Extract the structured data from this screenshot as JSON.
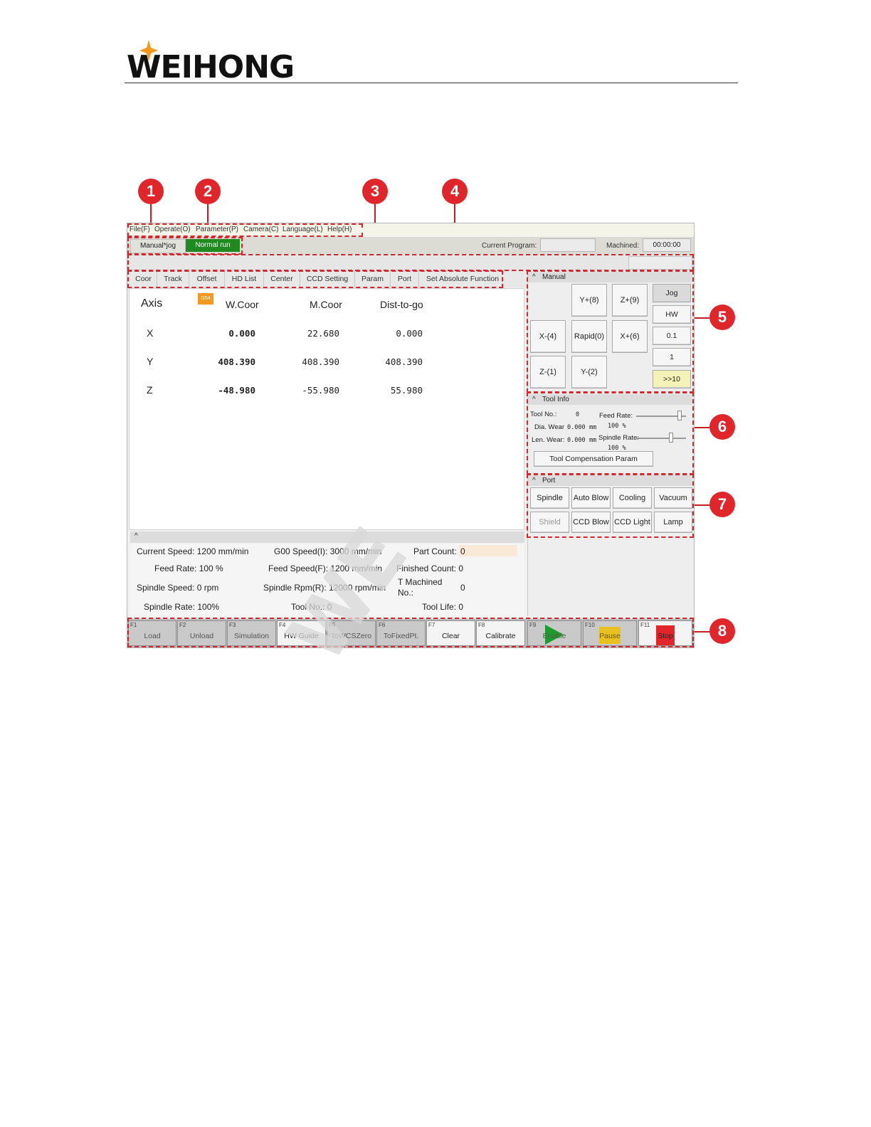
{
  "brand": {
    "name": "WEIHONG",
    "star_color": "#f39a1e"
  },
  "callouts": [
    "1",
    "2",
    "3",
    "4",
    "5",
    "6",
    "7",
    "8"
  ],
  "menu": [
    "File(F)",
    "Operate(O)",
    "Parameter(P)",
    "Camera(C)",
    "Language(L)",
    "Help(H)"
  ],
  "modes": {
    "manual_jog": "Manual*jog",
    "normal_run": "Normal run",
    "active_color": "#1f8a1f"
  },
  "status": {
    "current_program_label": "Current Program:",
    "current_program": "",
    "machined_label": "Machined:",
    "machined": "00:00:00"
  },
  "tabs": [
    "Coor",
    "Track",
    "Offset",
    "HD List",
    "Center",
    "CCD Setting",
    "Param",
    "Port",
    "Set Absolute Function"
  ],
  "coor": {
    "headers": {
      "axis": "Axis",
      "wcoor": "W.Coor",
      "mcoor": "M.Coor",
      "dist": "Dist-to-go"
    },
    "badge": "G54",
    "rows": [
      {
        "axis": "X",
        "wcoor": "0.000",
        "mcoor": "22.680",
        "dist": "0.000"
      },
      {
        "axis": "Y",
        "wcoor": "408.390",
        "mcoor": "408.390",
        "dist": "408.390"
      },
      {
        "axis": "Z",
        "wcoor": "-48.980",
        "mcoor": "-55.980",
        "dist": "55.980"
      }
    ]
  },
  "info": {
    "collapse": "^",
    "current_speed": "Current Speed: 1200 mm/min",
    "g00_speed": "G00 Speed(I): 3000 mm/min",
    "part_count_label": "Part Count:",
    "part_count": "0",
    "feed_rate": "Feed Rate: 100 %",
    "feed_speed": "Feed Speed(F): 1200 mm/min",
    "finished_count": "Finished Count: 0",
    "spindle_speed": "Spindle Speed: 0 rpm",
    "spindle_rpm": "Spindle Rpm(R): 12000 rpm/min",
    "t_machined_label": "T Machined No.:",
    "t_machined": "0",
    "spindle_rate": "Spindle Rate: 100%",
    "tool_no": "Tool No.: 0",
    "tool_life": "Tool Life: 0"
  },
  "manual": {
    "title": "Manual",
    "buttons": {
      "y_plus": "Y+(8)",
      "z_plus": "Z+(9)",
      "x_minus": "X-(4)",
      "rapid": "Rapid(0)",
      "x_plus": "X+(6)",
      "z_minus": "Z-(1)",
      "y_minus": "Y-(2)"
    },
    "modes": [
      "Jog",
      "HW",
      "0.1",
      "1",
      ">>10"
    ],
    "highlight_color": "#f5f2b8"
  },
  "tool_info": {
    "title": "Tool Info",
    "tool_no_label": "Tool No.:",
    "tool_no": "0",
    "feed_rate_label": "Feed Rate:",
    "feed_rate_pct": "100 %",
    "feed_rate_level": 0.9,
    "dia_wear_label": "Dia. Wear",
    "dia_wear": "0.000",
    "unit": "mm",
    "len_wear_label": "Len. Wear:",
    "len_wear": "0.000",
    "spindle_rate_label": "Spindle Rate:",
    "spindle_rate_pct": "100 %",
    "spindle_rate_level": 0.8,
    "comp_button": "Tool Compensation Param"
  },
  "port": {
    "title": "Port",
    "buttons": [
      "Spindle",
      "Auto Blow",
      "Cooling",
      "Vacuum",
      "Shield",
      "CCD Blow",
      "CCD Light",
      "Lamp"
    ]
  },
  "fkeys": [
    {
      "num": "F1",
      "label": "Load"
    },
    {
      "num": "F2",
      "label": "Unload"
    },
    {
      "num": "F3",
      "label": "Simulation"
    },
    {
      "num": "F4",
      "label": "HW Guide"
    },
    {
      "num": "F5",
      "label": "ToWCSZero"
    },
    {
      "num": "F6",
      "label": "ToFixedPt."
    },
    {
      "num": "F7",
      "label": "Clear"
    },
    {
      "num": "F8",
      "label": "Calibrate"
    },
    {
      "num": "F9",
      "label": "Enable"
    },
    {
      "num": "F10",
      "label": "Pause"
    },
    {
      "num": "F11",
      "label": "Stop"
    }
  ],
  "colors": {
    "callout": "#e0262b",
    "enable": "#1f9a2f",
    "pause": "#e8c020",
    "stop": "#e0262b"
  }
}
